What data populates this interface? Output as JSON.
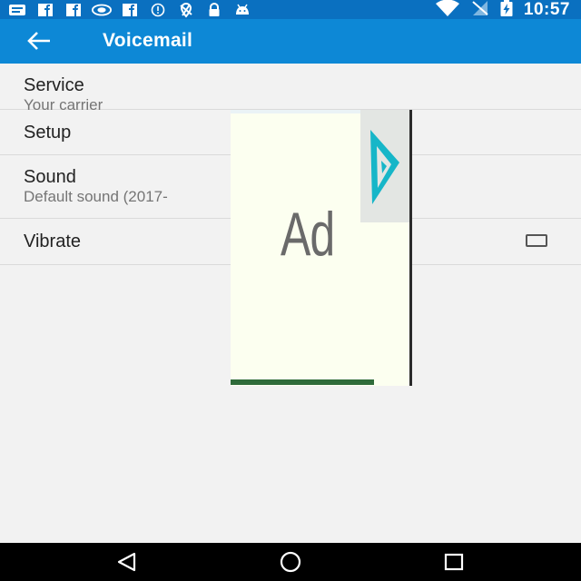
{
  "status_bar": {
    "time": "10:57",
    "left_icons": [
      "message-icon",
      "facebook-icon",
      "facebook-icon",
      "nvidia-icon",
      "facebook-icon",
      "info-icon",
      "no-location-icon",
      "lock-icon",
      "android-icon"
    ],
    "right_icons": [
      "wifi-icon",
      "no-sim-icon",
      "battery-charging-icon"
    ]
  },
  "app_bar": {
    "title": "Voicemail",
    "color": "#0d88d6"
  },
  "settings": [
    {
      "title": "Service",
      "subtitle": "Your carrier"
    },
    {
      "title": "Setup"
    },
    {
      "title": "Sound",
      "subtitle": "Default sound (2017-"
    },
    {
      "title": "Vibrate",
      "checked": false
    }
  ],
  "ad": {
    "label": "Ad"
  },
  "nav_bar": {
    "buttons": [
      "back-triangle-icon",
      "home-circle-icon",
      "recents-square-icon"
    ]
  }
}
